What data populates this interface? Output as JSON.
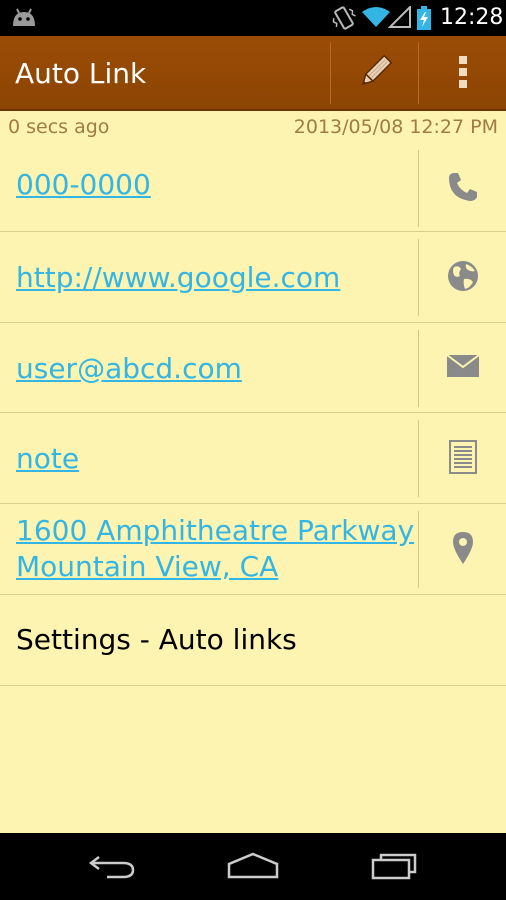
{
  "status_bar": {
    "time": "12:28",
    "icons": [
      "android-icon",
      "vibrate-icon",
      "wifi-icon",
      "signal-icon",
      "battery-icon"
    ]
  },
  "action_bar": {
    "title": "Auto Link",
    "actions": [
      "pencil-icon",
      "overflow-menu-icon"
    ],
    "background": "#9a4c05"
  },
  "note": {
    "relative_time": "0 secs ago",
    "timestamp": "2013/05/08 12:27 PM",
    "background": "#fcf4b0",
    "links": [
      {
        "text": "000-0000",
        "icon": "phone-icon"
      },
      {
        "text": "http://www.google.com",
        "icon": "globe-icon"
      },
      {
        "text": "user@abcd.com",
        "icon": "email-icon"
      },
      {
        "text": "note",
        "icon": "document-icon"
      },
      {
        "line1": "1600 Amphitheatre Parkway",
        "line2": "Mountain View, CA",
        "icon": "map-pin-icon"
      }
    ],
    "link_color": "#33b5e5",
    "settings_label": "Settings - Auto links"
  },
  "nav_bar": {
    "buttons": [
      "back-icon",
      "home-icon",
      "recent-apps-icon"
    ]
  }
}
